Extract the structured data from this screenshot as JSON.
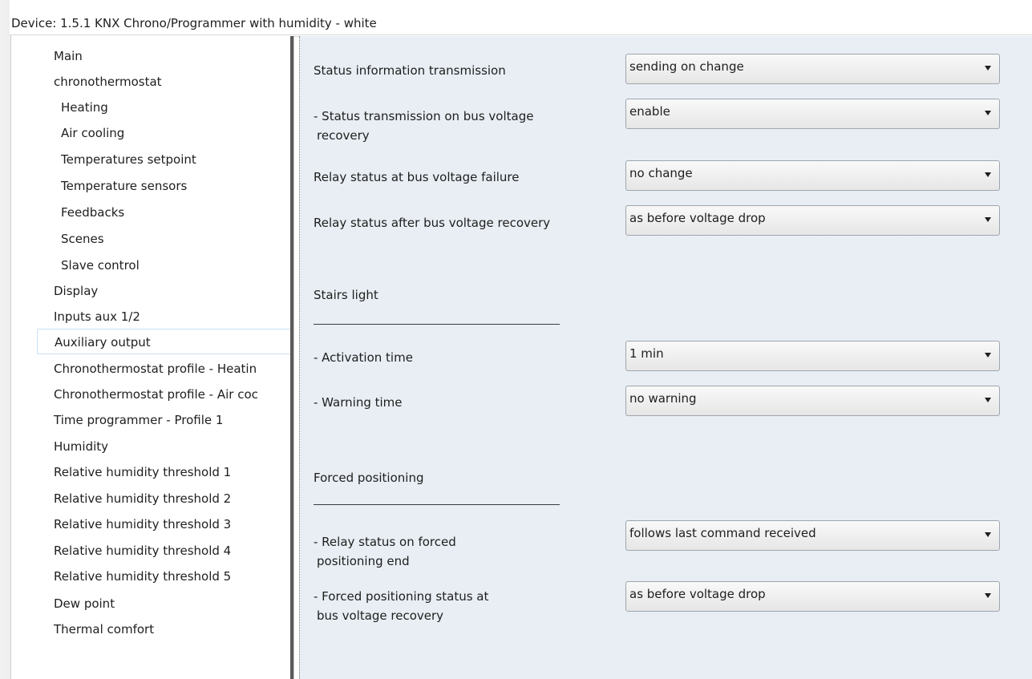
{
  "window": {
    "title": "Device: 1.5.1  KNX Chrono/Programmer with humidity - white"
  },
  "sidebar": {
    "items": [
      {
        "label": "Main"
      },
      {
        "label": "chronothermostat"
      },
      {
        "label": "Heating"
      },
      {
        "label": "Air cooling"
      },
      {
        "label": "Temperatures setpoint"
      },
      {
        "label": "Temperature sensors"
      },
      {
        "label": "Feedbacks"
      },
      {
        "label": "Scenes"
      },
      {
        "label": "Slave control"
      },
      {
        "label": "Display"
      },
      {
        "label": "Inputs aux 1/2"
      },
      {
        "label": "Auxiliary output"
      },
      {
        "label": "Chronothermostat profile - Heatin"
      },
      {
        "label": "Chronothermostat profile - Air coc"
      },
      {
        "label": "Time programmer - Profile 1"
      },
      {
        "label": "Humidity"
      },
      {
        "label": "Relative humidity threshold 1"
      },
      {
        "label": "Relative humidity threshold 2"
      },
      {
        "label": "Relative humidity threshold 3"
      },
      {
        "label": "Relative humidity threshold 4"
      },
      {
        "label": "Relative humidity threshold 5"
      },
      {
        "label": "Dew point"
      },
      {
        "label": "Thermal comfort"
      }
    ],
    "selected": "Auxiliary output"
  },
  "params": {
    "status_info": {
      "label": "Status information transmission",
      "value": "sending on change"
    },
    "status_recovery": {
      "label": "- Status transmission on bus voltage",
      "label2": "recovery",
      "value": "enable"
    },
    "relay_failure": {
      "label": "Relay status at bus voltage failure",
      "value": "no change"
    },
    "relay_recovery": {
      "label": "Relay status after bus voltage recovery",
      "value": "as before voltage drop"
    },
    "stairs_title": "Stairs light",
    "activation_time": {
      "label": "- Activation time",
      "value": "1 min"
    },
    "warning_time": {
      "label": "- Warning time",
      "value": "no warning"
    },
    "forced_title": "Forced positioning",
    "forced_end": {
      "label": "- Relay status on forced",
      "label2": "positioning end",
      "value": "follows last command received"
    },
    "forced_recovery": {
      "label": "- Forced positioning status at",
      "label2": "bus voltage recovery",
      "value": "as before voltage drop"
    }
  }
}
